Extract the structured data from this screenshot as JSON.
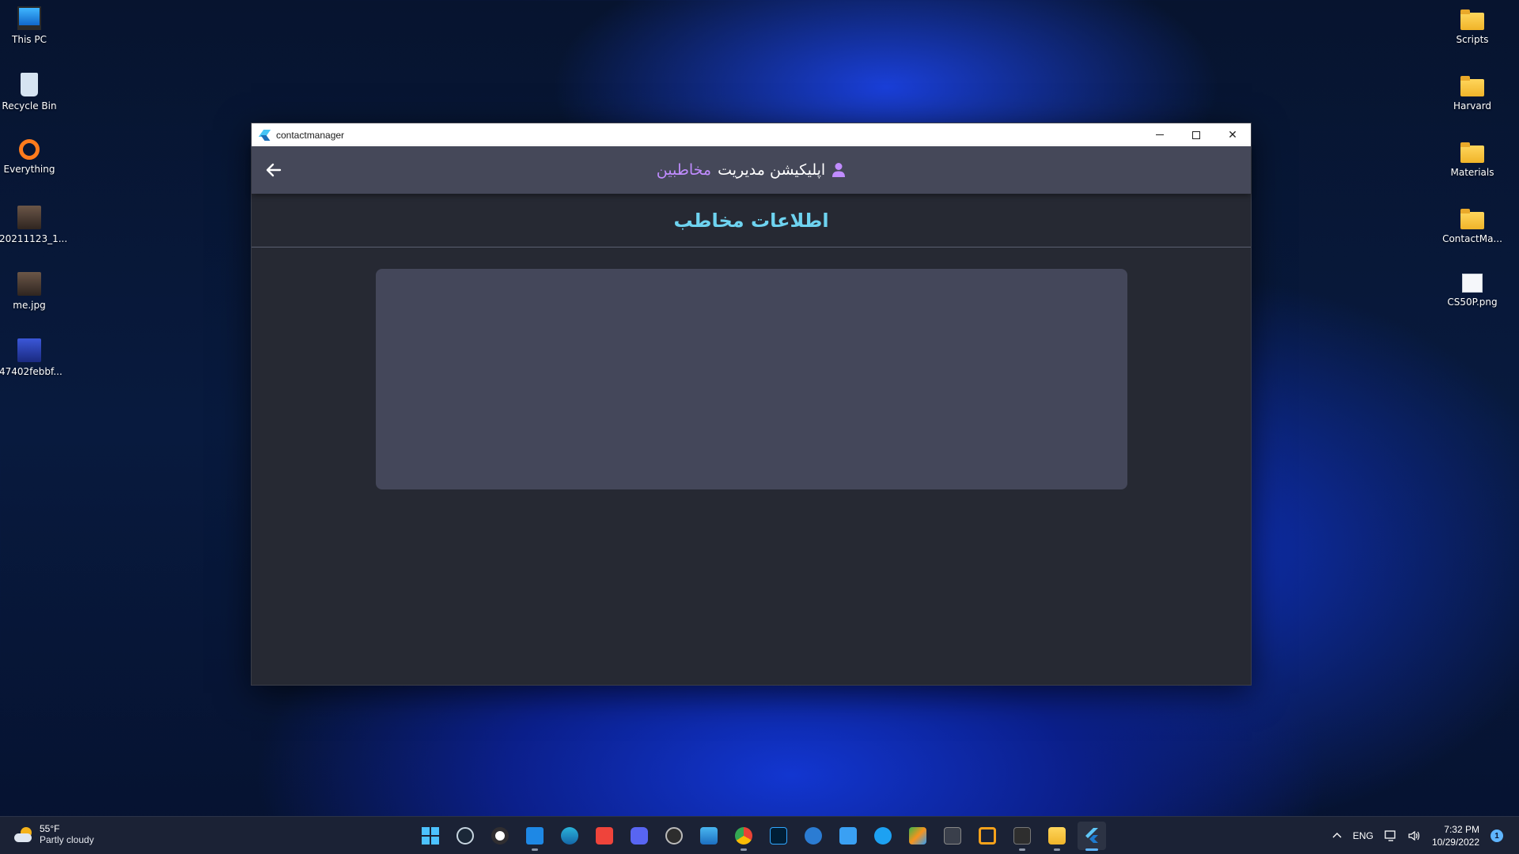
{
  "desktop": {
    "left_icons": [
      {
        "label": "This PC",
        "icon": "monitor-icon"
      },
      {
        "label": "Recycle Bin",
        "icon": "recycle-bin-icon"
      },
      {
        "label": "Everything",
        "icon": "everything-search-icon"
      },
      {
        "label": "20211123_1...",
        "icon": "photo-icon"
      },
      {
        "label": "me.jpg",
        "icon": "photo-icon"
      },
      {
        "label": "47402febbf...",
        "icon": "image-icon"
      }
    ],
    "right_icons": [
      {
        "label": "Scripts",
        "icon": "folder-icon"
      },
      {
        "label": "Harvard",
        "icon": "folder-icon"
      },
      {
        "label": "Materials",
        "icon": "folder-icon"
      },
      {
        "label": "ContactMa...",
        "icon": "folder-icon"
      },
      {
        "label": "CS50P.png",
        "icon": "png-file-icon"
      }
    ]
  },
  "window": {
    "title": "contactmanager",
    "controls": {
      "minimize": "minimize-icon",
      "maximize": "maximize-icon",
      "close": "✕"
    }
  },
  "app": {
    "title_main": "اپلیکیشن مدیریت",
    "title_accent": "مخاطبین",
    "section_title": "اطلاعات مخاطب",
    "accent_color": "#c08cff",
    "section_color": "#6ed3f0"
  },
  "taskbar": {
    "weather_temp": "55°F",
    "weather_desc": "Partly cloudy",
    "apps": [
      "windows-start-icon",
      "steam-icon",
      "obs-icon",
      "vscode-icon",
      "edge-dev-icon",
      "anydesk-icon",
      "discord-icon",
      "aperture-icon",
      "remote-desktop-icon",
      "chrome-icon",
      "photoshop-icon",
      "word-icon",
      "notepad-icon",
      "bird-icon",
      "v-icon",
      "kali-icon",
      "virtualbox-icon",
      "terminal-icon",
      "file-explorer-icon",
      "flutter-app-icon"
    ],
    "language": "ENG",
    "time": "7:32 PM",
    "date": "10/29/2022",
    "notification_count": "1"
  }
}
